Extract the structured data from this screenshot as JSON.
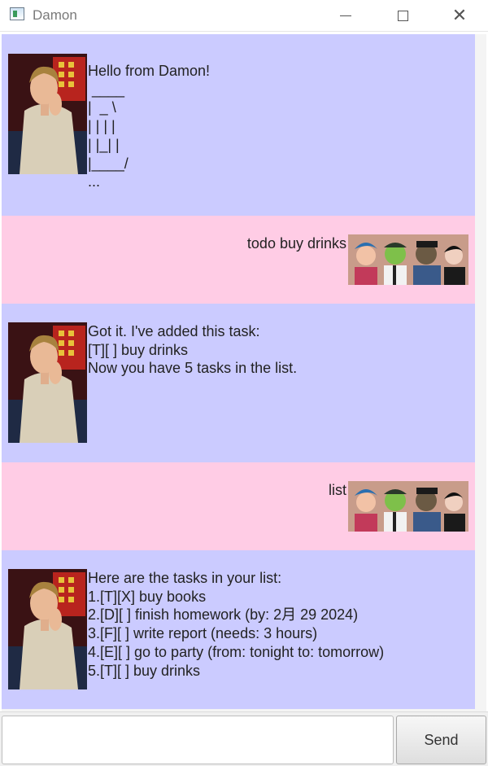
{
  "window": {
    "title": "Damon",
    "icon": "app-icon"
  },
  "window_controls": [
    "minimize-icon",
    "maximize-icon",
    "close-icon"
  ],
  "messages": [
    {
      "sender": "bot",
      "lines": [
        "Hello from Damon!",
        " ____",
        "|  _ \\",
        "| | | |",
        "| |_| |",
        "|____/",
        "..."
      ]
    },
    {
      "sender": "user",
      "text": "todo buy drinks"
    },
    {
      "sender": "bot",
      "lines": [
        "Got it. I've added this task:",
        "[T][ ] buy drinks",
        "Now you have 5 tasks in the list."
      ]
    },
    {
      "sender": "user",
      "text": "list"
    },
    {
      "sender": "bot",
      "lines": [
        "Here are the tasks in your list:",
        "1.[T][X] buy books",
        "2.[D][ ] finish homework (by: 2月 29 2024)",
        "3.[F][ ] write report (needs: 3 hours)",
        "4.[E][ ] go to party (from: tonight to: tomorrow)",
        "5.[T][ ] buy drinks"
      ]
    }
  ],
  "input": {
    "value": "",
    "placeholder": ""
  },
  "send_button": {
    "label": "Send"
  },
  "colors": {
    "bot_bubble": "#cbcbff",
    "user_bubble": "#ffcce5"
  }
}
